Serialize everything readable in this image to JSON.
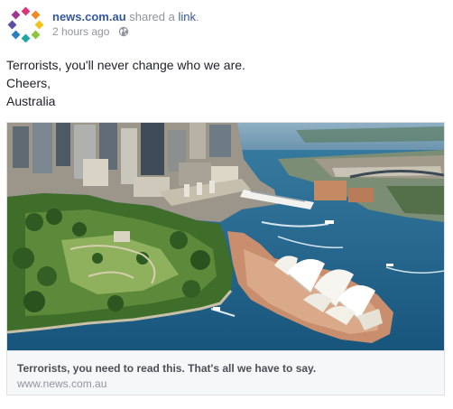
{
  "post": {
    "author": "news.com.au",
    "shared_text": "shared a",
    "shared_link": "link",
    "period": ".",
    "timestamp": "2 hours ago",
    "privacy_icon": "globe-icon",
    "message_lines": [
      "Terrorists, you'll never change who we are.",
      "Cheers,",
      "Australia"
    ]
  },
  "attachment": {
    "image_icon": "sydney-opera-house-aerial-photo",
    "title": "Terrorists, you need to read this. That's all we have to say.",
    "url": "www.news.com.au"
  },
  "colors": {
    "link_blue": "#365899",
    "meta_gray": "#90949c",
    "water": "#1d5f86",
    "park_green": "#3f6d2a"
  }
}
